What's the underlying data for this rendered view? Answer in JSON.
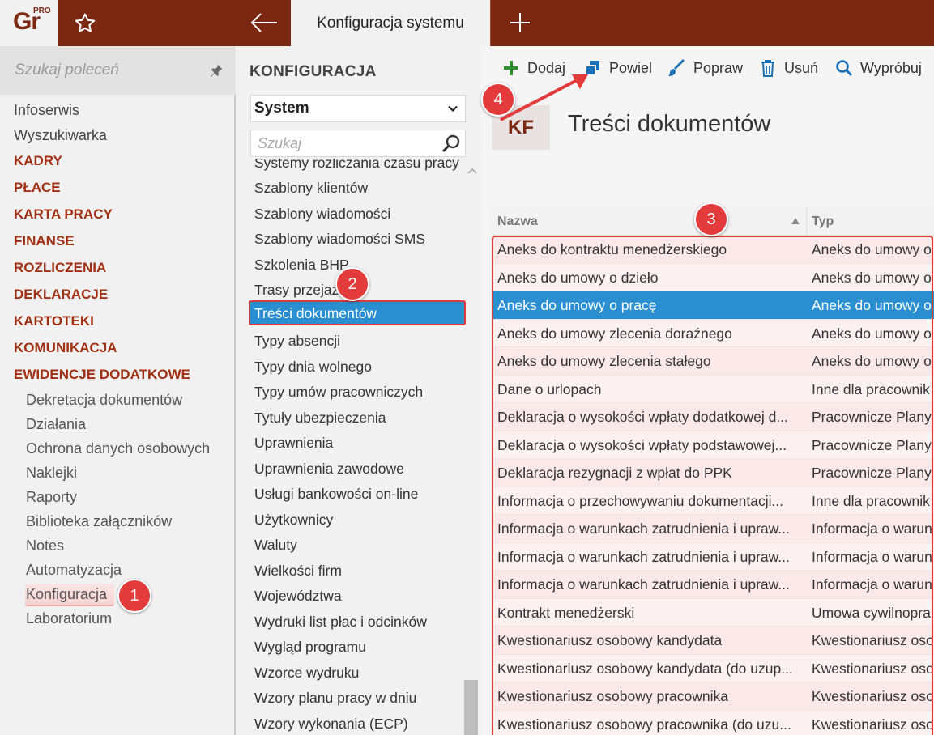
{
  "topbar": {
    "logo_text": "Gr",
    "logo_super": "PRO",
    "active_tab": "Konfiguracja systemu"
  },
  "sidebar": {
    "search_placeholder": "Szukaj poleceń",
    "top_items": [
      "Infoserwis",
      "Wyszukiwarka"
    ],
    "categories": [
      "KADRY",
      "PŁACE",
      "KARTA PRACY",
      "FINANSE",
      "ROZLICZENIA",
      "DEKLARACJE",
      "KARTOTEKI",
      "KOMUNIKACJA",
      "EWIDENCJE DODATKOWE"
    ],
    "sub_items": [
      "Dekretacja dokumentów",
      "Działania",
      "Ochrona danych osobowych",
      "Naklejki",
      "Raporty",
      "Biblioteka załączników",
      "Notes",
      "Automatyzacja",
      "Konfiguracja",
      "Laboratorium"
    ]
  },
  "middle": {
    "header": "KONFIGURACJA",
    "select_value": "System",
    "search_placeholder": "Szukaj",
    "items": [
      "Systemy rozliczania czasu pracy",
      "Szablony klientów",
      "Szablony wiadomości",
      "Szablony wiadomości SMS",
      "Szkolenia BHP",
      "Trasy przejazdu",
      "Treści dokumentów",
      "Typy absencji",
      "Typy dnia wolnego",
      "Typy umów pracowniczych",
      "Tytuły ubezpieczenia",
      "Uprawnienia",
      "Uprawnienia zawodowe",
      "Usługi bankowości on-line",
      "Użytkownicy",
      "Waluty",
      "Wielkości firm",
      "Województwa",
      "Wydruki list płac i odcinków",
      "Wygląd programu",
      "Wzorce wydruku",
      "Wzory planu pracy w dniu",
      "Wzory wykonania (ECP)"
    ],
    "selected_item": "Treści dokumentów"
  },
  "toolbar": {
    "add": "Dodaj",
    "duplicate": "Powiel",
    "edit": "Popraw",
    "delete": "Usuń",
    "try": "Wypróbuj"
  },
  "page": {
    "badge": "KF",
    "title": "Treści dokumentów"
  },
  "grid": {
    "col_name": "Nazwa",
    "col_type": "Typ",
    "rows": [
      {
        "name": "Aneks do kontraktu menedżerskiego",
        "type": "Aneks do umowy o"
      },
      {
        "name": "Aneks do umowy o dzieło",
        "type": "Aneks do umowy o"
      },
      {
        "name": "Aneks do umowy o pracę",
        "type": "Aneks do umowy o"
      },
      {
        "name": "Aneks do umowy zlecenia doraźnego",
        "type": "Aneks do umowy o"
      },
      {
        "name": "Aneks do umowy zlecenia stałego",
        "type": "Aneks do umowy o"
      },
      {
        "name": "Dane o urlopach",
        "type": "Inne dla pracownik"
      },
      {
        "name": "Deklaracja o wysokości wpłaty dodatkowej d...",
        "type": "Pracownicze Plany"
      },
      {
        "name": "Deklaracja o wysokości wpłaty podstawowej...",
        "type": "Pracownicze Plany"
      },
      {
        "name": "Deklaracja rezygnacji z wpłat do PPK",
        "type": "Pracownicze Plany"
      },
      {
        "name": "Informacja o przechowywaniu dokumentacji...",
        "type": "Inne dla pracownik"
      },
      {
        "name": "Informacja o warunkach zatrudnienia i upraw...",
        "type": "Informacja o warun"
      },
      {
        "name": "Informacja o warunkach zatrudnienia i upraw...",
        "type": "Informacja o warun"
      },
      {
        "name": "Informacja o warunkach zatrudnienia i upraw...",
        "type": "Informacja o warun"
      },
      {
        "name": "Kontrakt menedżerski",
        "type": "Umowa cywilnopra"
      },
      {
        "name": "Kwestionariusz osobowy kandydata",
        "type": "Kwestionariusz oso"
      },
      {
        "name": "Kwestionariusz osobowy kandydata (do uzup...",
        "type": "Kwestionariusz oso"
      },
      {
        "name": "Kwestionariusz osobowy pracownika",
        "type": "Kwestionariusz oso"
      },
      {
        "name": "Kwestionariusz osobowy pracownika (do uzu...",
        "type": "Kwestionariusz oso"
      }
    ],
    "selected_index": 2
  },
  "annotations": [
    "1",
    "2",
    "3",
    "4"
  ],
  "colors": {
    "brand": "#7a2812",
    "category": "#a12f12",
    "selection": "#2a8fd0",
    "annotation": "#e33b3b"
  }
}
